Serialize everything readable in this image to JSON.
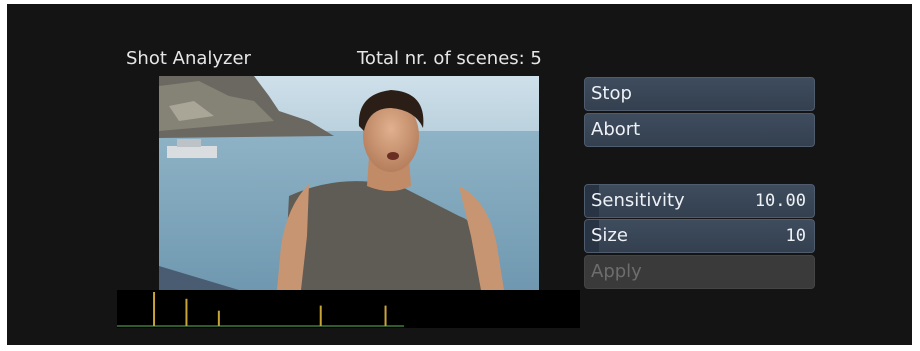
{
  "header": {
    "title": "Shot Analyzer",
    "scenes_label": "Total nr. of scenes: 5"
  },
  "buttons": {
    "stop": "Stop",
    "abort": "Abort",
    "apply": "Apply"
  },
  "sliders": {
    "sensitivity": {
      "label": "Sensitivity",
      "value": "10.00",
      "fill_fraction": 0.06
    },
    "size": {
      "label": "Size",
      "value": "10",
      "fill_fraction": 0.06
    }
  },
  "histogram": {
    "peaks_fraction_of_width": [
      0.08,
      0.15,
      0.22,
      0.44,
      0.58
    ],
    "peak_heights": [
      1.0,
      0.8,
      0.45,
      0.6,
      0.6
    ],
    "colors": {
      "peak": "#c9a437",
      "baseline": "#3e7a3c"
    }
  },
  "colors": {
    "background": "#141414",
    "button": "#3a4657",
    "button_text": "#eef1f5",
    "disabled_text": "#6d6d6d"
  }
}
